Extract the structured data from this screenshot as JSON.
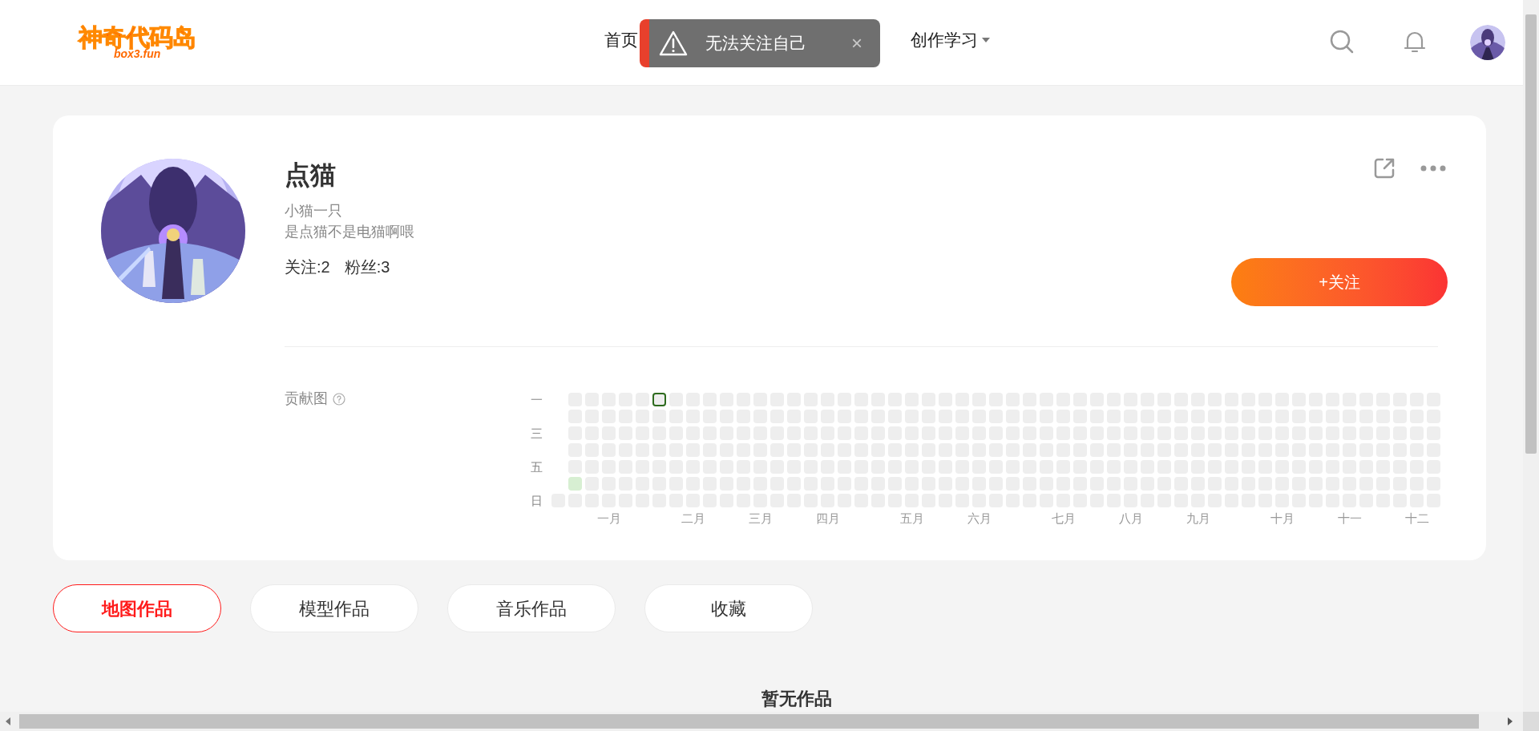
{
  "header": {
    "logo": {
      "title": "神奇代码岛",
      "subtitle": "box3.fun"
    },
    "nav": [
      {
        "label": "首页",
        "dropdown": false
      },
      {
        "label": "创作学习",
        "dropdown": true
      }
    ]
  },
  "toast": {
    "message": "无法关注自己",
    "close": "×"
  },
  "profile": {
    "name": "点猫",
    "bio": [
      "小猫一只",
      "是点猫不是电猫啊喂"
    ],
    "stats": [
      "关注:2",
      "粉丝:3"
    ],
    "follow_button": "+关注"
  },
  "contribution": {
    "label": "贡献图",
    "row_labels": [
      "一",
      "三",
      "五",
      "日"
    ],
    "months": [
      "一月",
      "二月",
      "三月",
      "四月",
      "五月",
      "六月",
      "七月",
      "八月",
      "九月",
      "十月",
      "十一",
      "十二"
    ],
    "weeks": [
      [
        {
          "active": false
        }
      ],
      [
        {
          "active": false
        },
        {
          "active": false
        },
        {
          "active": false
        },
        {
          "active": false
        },
        {
          "active": false
        },
        {
          "active": true
        },
        {
          "active": false
        }
      ],
      [
        {
          "active": false
        },
        {
          "active": false
        },
        {
          "active": false
        },
        {
          "active": false
        },
        {
          "active": false
        },
        {
          "active": false
        },
        {
          "active": false
        }
      ],
      [
        {
          "active": false
        },
        {
          "active": false
        },
        {
          "active": false
        },
        {
          "active": false
        },
        {
          "active": false
        },
        {
          "active": false
        },
        {
          "active": false
        }
      ],
      [
        {
          "active": false
        },
        {
          "active": false
        },
        {
          "active": false
        },
        {
          "active": false
        },
        {
          "active": false
        },
        {
          "active": false
        },
        {
          "active": false
        }
      ],
      [
        {
          "active": false
        },
        {
          "active": false
        },
        {
          "active": false
        },
        {
          "active": false
        },
        {
          "active": false
        },
        {
          "active": false
        },
        {
          "active": false
        }
      ],
      [
        {
          "active": false,
          "today": true
        },
        {
          "active": false
        },
        {
          "active": false
        },
        {
          "active": false
        },
        {
          "active": false
        },
        {
          "active": false
        },
        {
          "active": false
        }
      ],
      [
        {
          "active": false
        },
        {
          "active": false
        },
        {
          "active": false
        },
        {
          "active": false
        },
        {
          "active": false
        },
        {
          "active": false
        },
        {
          "active": false
        }
      ],
      [
        {
          "active": false
        },
        {
          "active": false
        },
        {
          "active": false
        },
        {
          "active": false
        },
        {
          "active": false
        },
        {
          "active": false
        },
        {
          "active": false
        }
      ],
      [
        {
          "active": false
        },
        {
          "active": false
        },
        {
          "active": false
        },
        {
          "active": false
        },
        {
          "active": false
        },
        {
          "active": false
        },
        {
          "active": false
        }
      ],
      [
        {
          "active": false
        },
        {
          "active": false
        },
        {
          "active": false
        },
        {
          "active": false
        },
        {
          "active": false
        },
        {
          "active": false
        },
        {
          "active": false
        }
      ],
      [
        {
          "active": false
        },
        {
          "active": false
        },
        {
          "active": false
        },
        {
          "active": false
        },
        {
          "active": false
        },
        {
          "active": false
        },
        {
          "active": false
        }
      ],
      [
        {
          "active": false
        },
        {
          "active": false
        },
        {
          "active": false
        },
        {
          "active": false
        },
        {
          "active": false
        },
        {
          "active": false
        },
        {
          "active": false
        }
      ],
      [
        {
          "active": false
        },
        {
          "active": false
        },
        {
          "active": false
        },
        {
          "active": false
        },
        {
          "active": false
        },
        {
          "active": false
        },
        {
          "active": false
        }
      ],
      [
        {
          "active": false
        },
        {
          "active": false
        },
        {
          "active": false
        },
        {
          "active": false
        },
        {
          "active": false
        },
        {
          "active": false
        },
        {
          "active": false
        }
      ],
      [
        {
          "active": false
        },
        {
          "active": false
        },
        {
          "active": false
        },
        {
          "active": false
        },
        {
          "active": false
        },
        {
          "active": false
        },
        {
          "active": false
        }
      ],
      [
        {
          "active": false
        },
        {
          "active": false
        },
        {
          "active": false
        },
        {
          "active": false
        },
        {
          "active": false
        },
        {
          "active": false
        },
        {
          "active": false
        }
      ],
      [
        {
          "active": false
        },
        {
          "active": false
        },
        {
          "active": false
        },
        {
          "active": false
        },
        {
          "active": false
        },
        {
          "active": false
        },
        {
          "active": false
        }
      ],
      [
        {
          "active": false
        },
        {
          "active": false
        },
        {
          "active": false
        },
        {
          "active": false
        },
        {
          "active": false
        },
        {
          "active": false
        },
        {
          "active": false
        }
      ],
      [
        {
          "active": false
        },
        {
          "active": false
        },
        {
          "active": false
        },
        {
          "active": false
        },
        {
          "active": false
        },
        {
          "active": false
        },
        {
          "active": false
        }
      ],
      [
        {
          "active": false
        },
        {
          "active": false
        },
        {
          "active": false
        },
        {
          "active": false
        },
        {
          "active": false
        },
        {
          "active": false
        },
        {
          "active": false
        }
      ],
      [
        {
          "active": false
        },
        {
          "active": false
        },
        {
          "active": false
        },
        {
          "active": false
        },
        {
          "active": false
        },
        {
          "active": false
        },
        {
          "active": false
        }
      ],
      [
        {
          "active": false
        },
        {
          "active": false
        },
        {
          "active": false
        },
        {
          "active": false
        },
        {
          "active": false
        },
        {
          "active": false
        },
        {
          "active": false
        }
      ],
      [
        {
          "active": false
        },
        {
          "active": false
        },
        {
          "active": false
        },
        {
          "active": false
        },
        {
          "active": false
        },
        {
          "active": false
        },
        {
          "active": false
        }
      ],
      [
        {
          "active": false
        },
        {
          "active": false
        },
        {
          "active": false
        },
        {
          "active": false
        },
        {
          "active": false
        },
        {
          "active": false
        },
        {
          "active": false
        }
      ],
      [
        {
          "active": false
        },
        {
          "active": false
        },
        {
          "active": false
        },
        {
          "active": false
        },
        {
          "active": false
        },
        {
          "active": false
        },
        {
          "active": false
        }
      ],
      [
        {
          "active": false
        },
        {
          "active": false
        },
        {
          "active": false
        },
        {
          "active": false
        },
        {
          "active": false
        },
        {
          "active": false
        },
        {
          "active": false
        }
      ],
      [
        {
          "active": false
        },
        {
          "active": false
        },
        {
          "active": false
        },
        {
          "active": false
        },
        {
          "active": false
        },
        {
          "active": false
        },
        {
          "active": false
        }
      ],
      [
        {
          "active": false
        },
        {
          "active": false
        },
        {
          "active": false
        },
        {
          "active": false
        },
        {
          "active": false
        },
        {
          "active": false
        },
        {
          "active": false
        }
      ],
      [
        {
          "active": false
        },
        {
          "active": false
        },
        {
          "active": false
        },
        {
          "active": false
        },
        {
          "active": false
        },
        {
          "active": false
        },
        {
          "active": false
        }
      ],
      [
        {
          "active": false
        },
        {
          "active": false
        },
        {
          "active": false
        },
        {
          "active": false
        },
        {
          "active": false
        },
        {
          "active": false
        },
        {
          "active": false
        }
      ],
      [
        {
          "active": false
        },
        {
          "active": false
        },
        {
          "active": false
        },
        {
          "active": false
        },
        {
          "active": false
        },
        {
          "active": false
        },
        {
          "active": false
        }
      ],
      [
        {
          "active": false
        },
        {
          "active": false
        },
        {
          "active": false
        },
        {
          "active": false
        },
        {
          "active": false
        },
        {
          "active": false
        },
        {
          "active": false
        }
      ],
      [
        {
          "active": false
        },
        {
          "active": false
        },
        {
          "active": false
        },
        {
          "active": false
        },
        {
          "active": false
        },
        {
          "active": false
        },
        {
          "active": false
        }
      ],
      [
        {
          "active": false
        },
        {
          "active": false
        },
        {
          "active": false
        },
        {
          "active": false
        },
        {
          "active": false
        },
        {
          "active": false
        },
        {
          "active": false
        }
      ],
      [
        {
          "active": false
        },
        {
          "active": false
        },
        {
          "active": false
        },
        {
          "active": false
        },
        {
          "active": false
        },
        {
          "active": false
        },
        {
          "active": false
        }
      ],
      [
        {
          "active": false
        },
        {
          "active": false
        },
        {
          "active": false
        },
        {
          "active": false
        },
        {
          "active": false
        },
        {
          "active": false
        },
        {
          "active": false
        }
      ],
      [
        {
          "active": false
        },
        {
          "active": false
        },
        {
          "active": false
        },
        {
          "active": false
        },
        {
          "active": false
        },
        {
          "active": false
        },
        {
          "active": false
        }
      ],
      [
        {
          "active": false
        },
        {
          "active": false
        },
        {
          "active": false
        },
        {
          "active": false
        },
        {
          "active": false
        },
        {
          "active": false
        },
        {
          "active": false
        }
      ],
      [
        {
          "active": false
        },
        {
          "active": false
        },
        {
          "active": false
        },
        {
          "active": false
        },
        {
          "active": false
        },
        {
          "active": false
        },
        {
          "active": false
        }
      ],
      [
        {
          "active": false
        },
        {
          "active": false
        },
        {
          "active": false
        },
        {
          "active": false
        },
        {
          "active": false
        },
        {
          "active": false
        },
        {
          "active": false
        }
      ],
      [
        {
          "active": false
        },
        {
          "active": false
        },
        {
          "active": false
        },
        {
          "active": false
        },
        {
          "active": false
        },
        {
          "active": false
        },
        {
          "active": false
        }
      ],
      [
        {
          "active": false
        },
        {
          "active": false
        },
        {
          "active": false
        },
        {
          "active": false
        },
        {
          "active": false
        },
        {
          "active": false
        },
        {
          "active": false
        }
      ],
      [
        {
          "active": false
        },
        {
          "active": false
        },
        {
          "active": false
        },
        {
          "active": false
        },
        {
          "active": false
        },
        {
          "active": false
        },
        {
          "active": false
        }
      ],
      [
        {
          "active": false
        },
        {
          "active": false
        },
        {
          "active": false
        },
        {
          "active": false
        },
        {
          "active": false
        },
        {
          "active": false
        },
        {
          "active": false
        }
      ],
      [
        {
          "active": false
        },
        {
          "active": false
        },
        {
          "active": false
        },
        {
          "active": false
        },
        {
          "active": false
        },
        {
          "active": false
        },
        {
          "active": false
        }
      ],
      [
        {
          "active": false
        },
        {
          "active": false
        },
        {
          "active": false
        },
        {
          "active": false
        },
        {
          "active": false
        },
        {
          "active": false
        },
        {
          "active": false
        }
      ],
      [
        {
          "active": false
        },
        {
          "active": false
        },
        {
          "active": false
        },
        {
          "active": false
        },
        {
          "active": false
        },
        {
          "active": false
        },
        {
          "active": false
        }
      ],
      [
        {
          "active": false
        },
        {
          "active": false
        },
        {
          "active": false
        },
        {
          "active": false
        },
        {
          "active": false
        },
        {
          "active": false
        },
        {
          "active": false
        }
      ],
      [
        {
          "active": false
        },
        {
          "active": false
        },
        {
          "active": false
        },
        {
          "active": false
        },
        {
          "active": false
        },
        {
          "active": false
        },
        {
          "active": false
        }
      ],
      [
        {
          "active": false
        },
        {
          "active": false
        },
        {
          "active": false
        },
        {
          "active": false
        },
        {
          "active": false
        },
        {
          "active": false
        },
        {
          "active": false
        }
      ],
      [
        {
          "active": false
        },
        {
          "active": false
        },
        {
          "active": false
        },
        {
          "active": false
        },
        {
          "active": false
        },
        {
          "active": false
        },
        {
          "active": false
        }
      ],
      [
        {
          "active": false
        },
        {
          "active": false
        },
        {
          "active": false
        },
        {
          "active": false
        },
        {
          "active": false
        },
        {
          "active": false
        },
        {
          "active": false
        }
      ]
    ]
  },
  "tabs": [
    {
      "label": "地图作品",
      "selected": true
    },
    {
      "label": "模型作品",
      "selected": false
    },
    {
      "label": "音乐作品",
      "selected": false
    },
    {
      "label": "收藏",
      "selected": false
    }
  ],
  "empty_message": "暂无作品"
}
